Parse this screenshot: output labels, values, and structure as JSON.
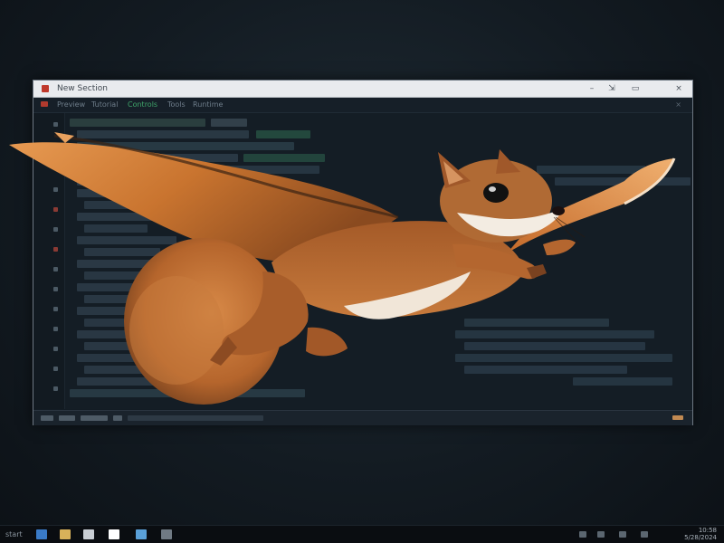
{
  "window": {
    "title": "New Section",
    "controls": {
      "minimize": "–",
      "restore": "⇲",
      "maximize": "▭",
      "close": "×"
    }
  },
  "menu": {
    "items": [
      "Preview",
      "Tutorial",
      "Controls",
      "Tools",
      "Runtime"
    ],
    "close_glyph": "×"
  },
  "taskbar": {
    "start_label": "start",
    "clock_time": "10:58",
    "clock_date": "5/28/2024"
  },
  "colors": {
    "desktop": "#131b22",
    "editor_bg": "#141d25",
    "accent_green": "#3fa56a",
    "accent_red": "#c0392b",
    "squirrel_fur": "#b5652c",
    "wing": "#d98638"
  },
  "icons": {
    "taskbar": [
      "search-icon",
      "file-explorer-icon",
      "document-icon",
      "media-player-icon",
      "image-viewer-icon",
      "settings-icon"
    ],
    "tray": [
      "chevron-up-icon",
      "network-icon",
      "volume-icon",
      "battery-icon"
    ]
  }
}
